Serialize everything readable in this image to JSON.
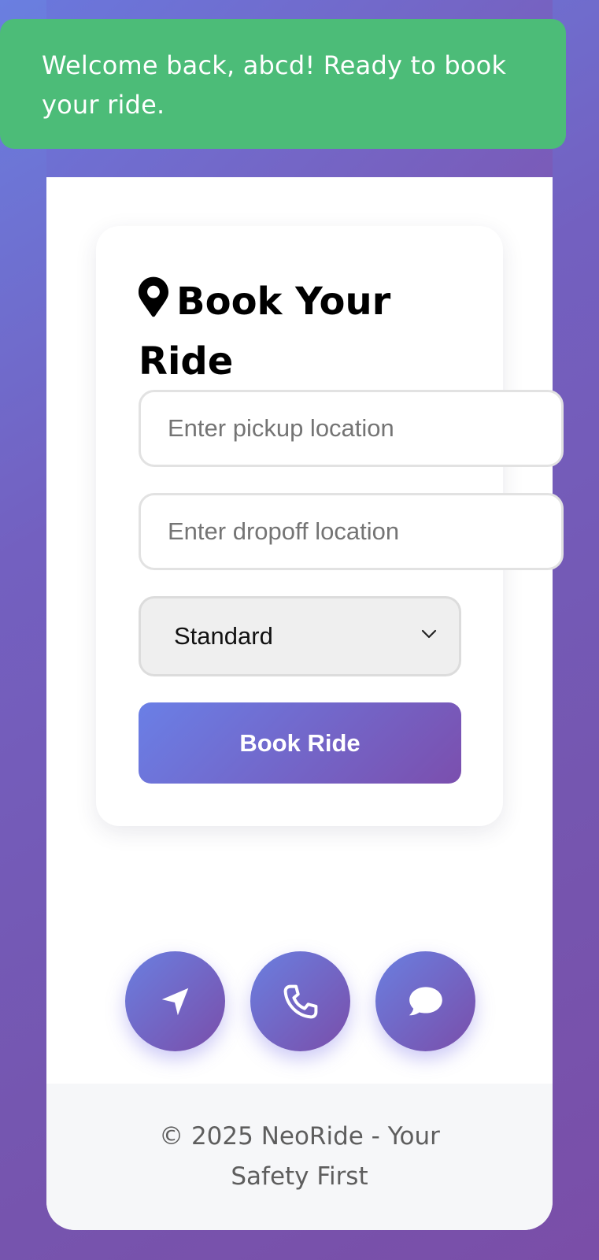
{
  "toast": {
    "message": "Welcome back, abcd! Ready to book your ride."
  },
  "booking": {
    "title": "Book Your Ride",
    "title_icon": "map-pin-icon",
    "pickup_placeholder": "Enter pickup location",
    "pickup_value": "",
    "dropoff_placeholder": "Enter dropoff location",
    "dropoff_value": "",
    "ride_type_selected": "Standard",
    "submit_label": "Book Ride"
  },
  "actions": [
    {
      "icon": "navigation-arrow-icon"
    },
    {
      "icon": "phone-icon"
    },
    {
      "icon": "chat-bubble-icon"
    }
  ],
  "footer": {
    "text": "© 2025 NeoRide - Your Safety First"
  },
  "colors": {
    "toast_bg": "#4cbc78",
    "gradient_start": "#6a7fe6",
    "gradient_end": "#7b4fae",
    "card_bg": "#ffffff",
    "footer_bg": "#f6f7f9"
  }
}
